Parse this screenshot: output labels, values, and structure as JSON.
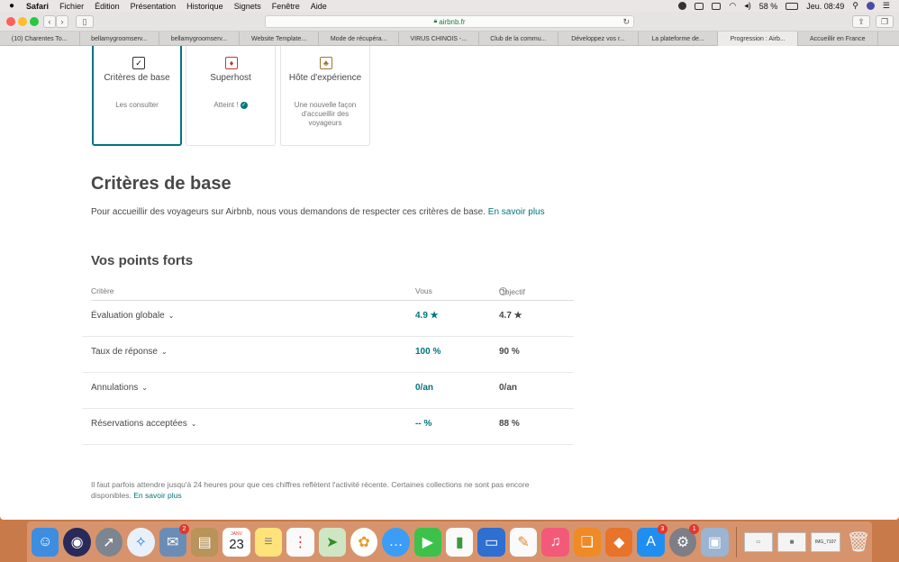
{
  "menubar": {
    "apple": "",
    "app": "Safari",
    "menus": [
      "Fichier",
      "Édition",
      "Présentation",
      "Historique",
      "Signets",
      "Fenêtre",
      "Aide"
    ],
    "battery": "58 %",
    "clock": "Jeu. 08:49"
  },
  "toolbar": {
    "back": "‹",
    "forward": "›",
    "url": "airbnb.fr",
    "reload": "↻"
  },
  "tabs": [
    "(10) Charentes To...",
    "bellamygroomserv...",
    "bellamygroomserv...",
    "Website Template...",
    "Mode de récupéra...",
    "VIRUS CHINOIS -...",
    "Club de la commu...",
    "Développez vos r...",
    "La plateforme de...",
    "Progression : Airb...",
    "Accueillir en France"
  ],
  "cards": [
    {
      "title": "Critères de base",
      "sub": "Les consulter",
      "icon": "clipboard-icon",
      "glyph": "✓"
    },
    {
      "title": "Superhost",
      "sub": "Atteint !",
      "icon": "medal-icon",
      "glyph": "♦"
    },
    {
      "title": "Hôte d'expérience",
      "sub": "Une nouvelle façon d'accueillir des voyageurs",
      "icon": "palm-tree-icon",
      "glyph": "♣"
    }
  ],
  "main": {
    "title": "Critères de base",
    "intro": "Pour accueillir des voyageurs sur Airbnb, nous vous demandons de respecter ces critères de base.",
    "intro_link": "En savoir plus",
    "section_title": "Vos points forts",
    "col_critere": "Critère",
    "col_vous": "Vous",
    "col_objectif": "Objectif",
    "rows": [
      {
        "label": "Évaluation globale",
        "you": "4.9 ★",
        "goal": "4.7 ★"
      },
      {
        "label": "Taux de réponse",
        "you": "100 %",
        "goal": "90 %"
      },
      {
        "label": "Annulations",
        "you": "0/an",
        "goal": "0/an"
      },
      {
        "label": "Réservations acceptées",
        "you": "-- %",
        "goal": "88 %"
      }
    ],
    "footnote": "Il faut parfois attendre jusqu'à 24 heures pour que ces chiffres reflètent l'activité récente. Certaines collections ne sont pas encore disponibles.",
    "footnote_link": "En savoir plus"
  },
  "dock": {
    "calendar_month": "JANV",
    "calendar_day": "23",
    "badges": {
      "contacts": "2",
      "appstore": "3",
      "prefs": "1"
    },
    "thumb_label": "IMG_7107"
  },
  "colors": {
    "accent": "#00767c",
    "text": "#484848",
    "muted": "#767676"
  }
}
